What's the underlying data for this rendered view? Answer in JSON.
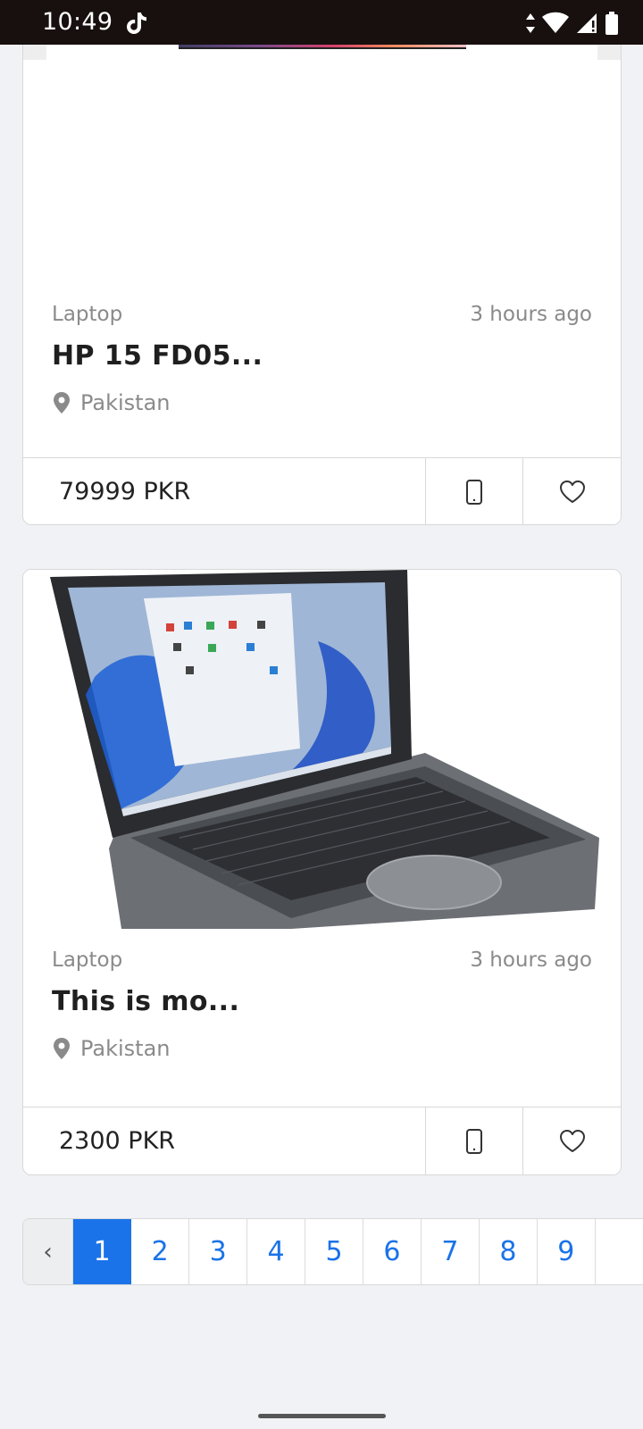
{
  "status_bar": {
    "time": "10:49",
    "icons": [
      "tiktok-icon",
      "data-arrows-icon",
      "wifi-icon",
      "signal-icon",
      "battery-icon"
    ]
  },
  "listings": [
    {
      "category": "Laptop",
      "time_ago": "3 hours ago",
      "title": "HP 15 FD05...",
      "location": "Pakistan",
      "price": "79999 PKR"
    },
    {
      "category": "Laptop",
      "time_ago": "3 hours ago",
      "title": "This is mo...",
      "location": "Pakistan",
      "price": "2300 PKR"
    }
  ],
  "pagination": {
    "prev_label": "‹",
    "pages": [
      "1",
      "2",
      "3",
      "4",
      "5",
      "6",
      "7",
      "8",
      "9"
    ],
    "current_page": "1"
  },
  "colors": {
    "accent": "#1a73e8",
    "background": "#f0f2f5",
    "status_bar": "#17100f"
  }
}
